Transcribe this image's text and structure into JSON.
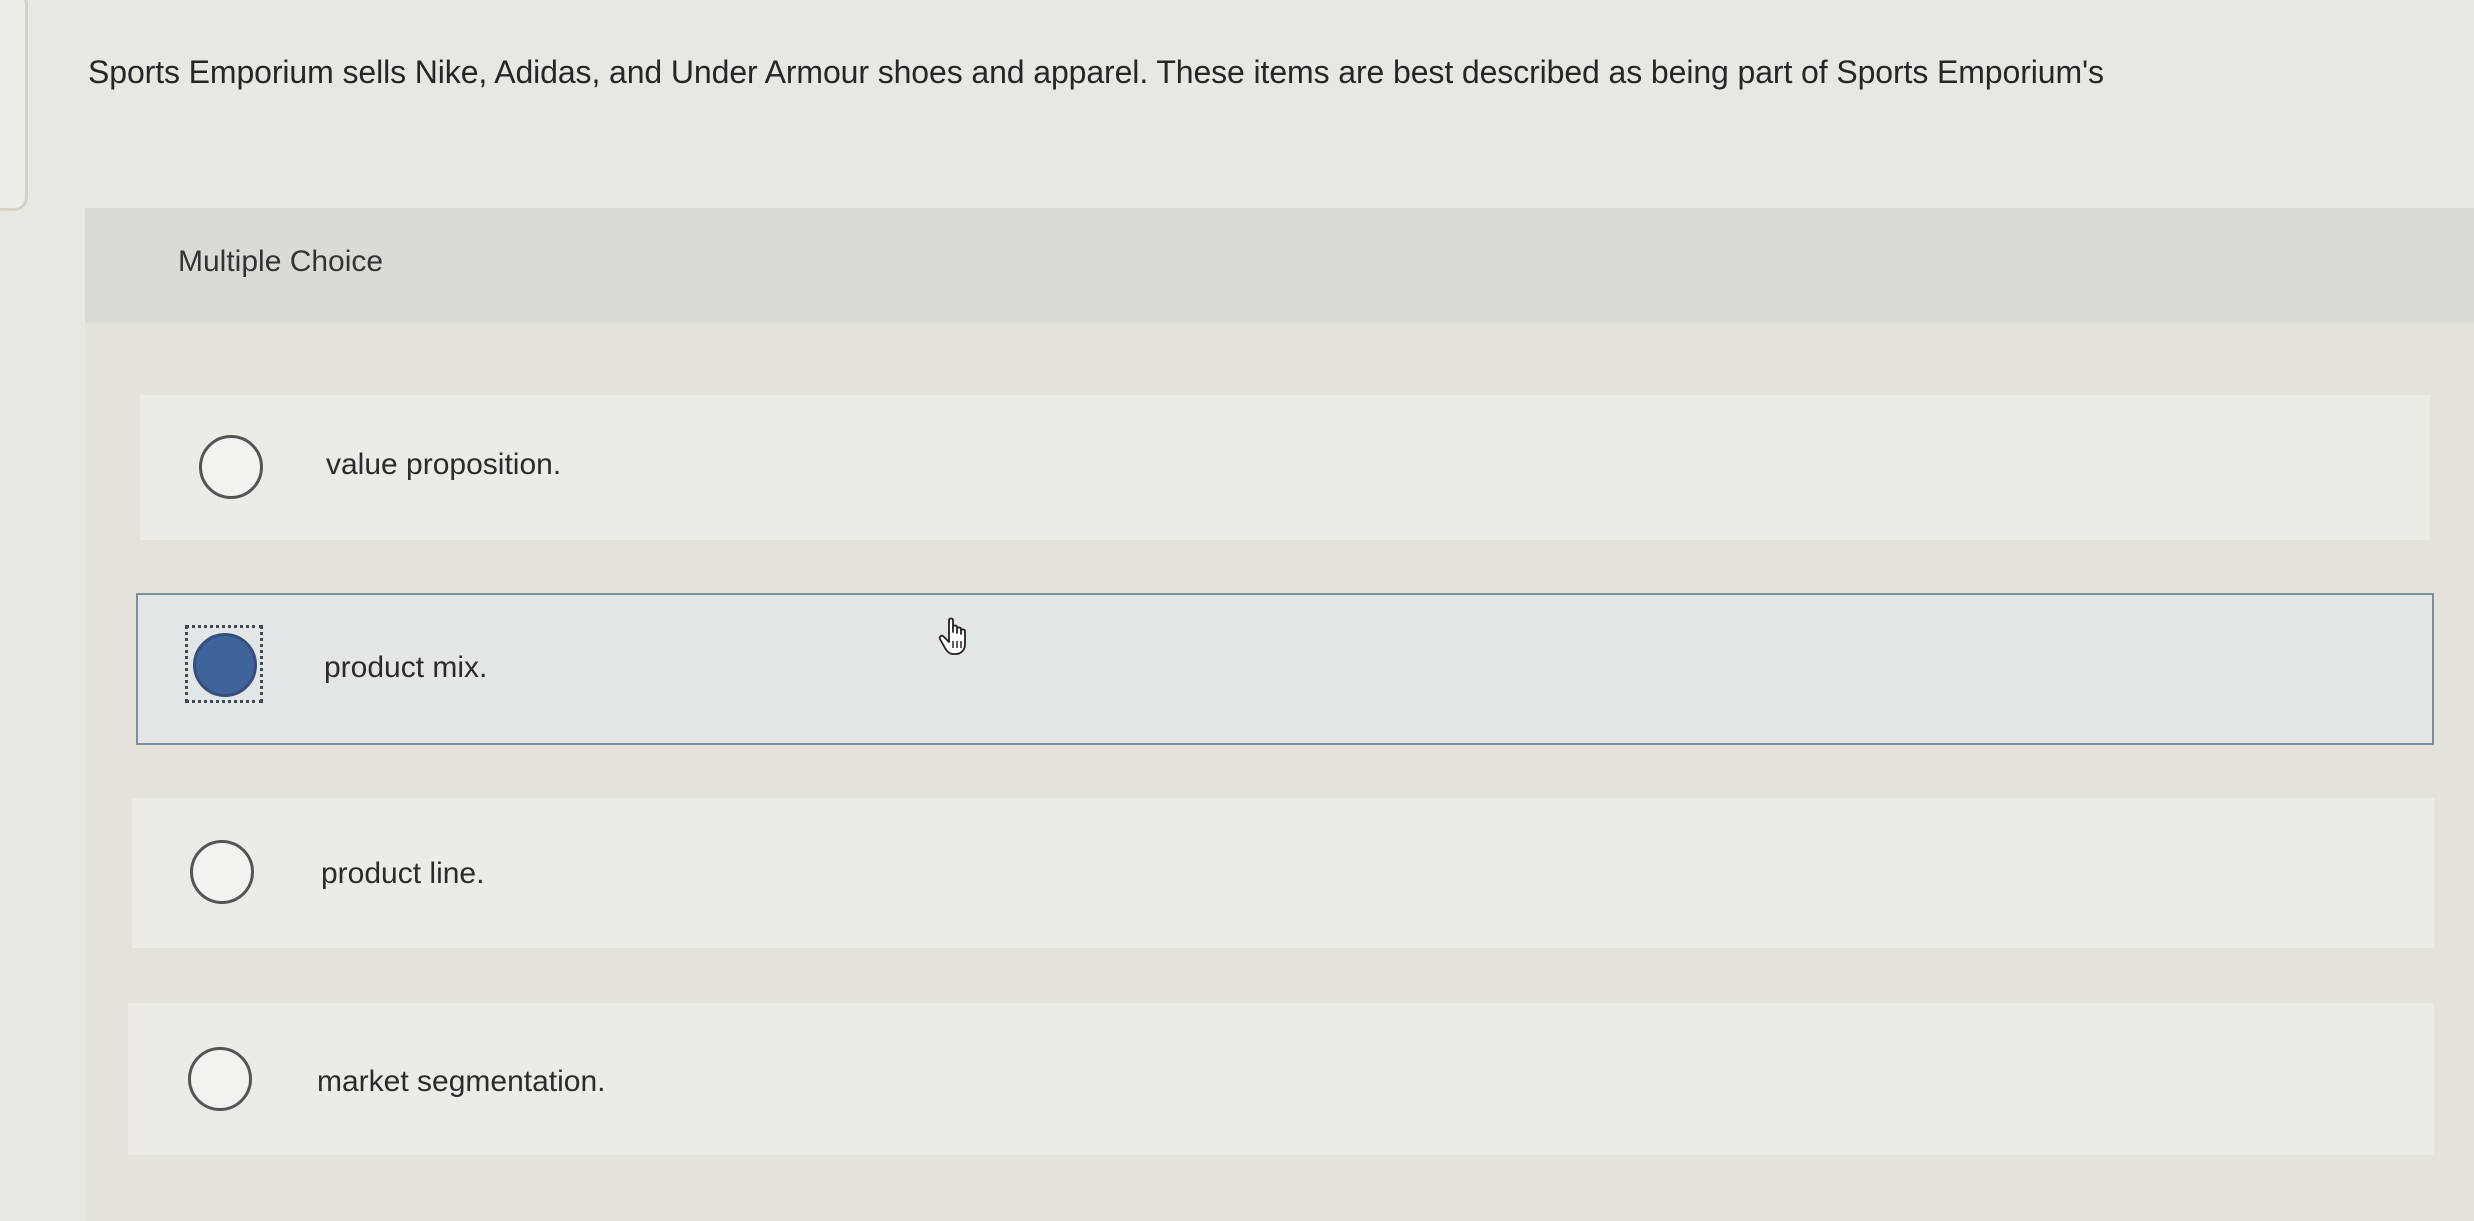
{
  "question": {
    "text": "Sports Emporium sells Nike, Adidas, and Under Armour shoes and apparel. These items are best described as being part of Sports Emporium's"
  },
  "section": {
    "label": "Multiple Choice"
  },
  "options": [
    {
      "label": "value proposition.",
      "selected": false
    },
    {
      "label": "product mix.",
      "selected": true
    },
    {
      "label": "product line.",
      "selected": false
    },
    {
      "label": "market segmentation.",
      "selected": false
    }
  ],
  "colors": {
    "selected_radio": "#3f639b",
    "selected_row_border": "#7f8e9c"
  },
  "icons": {
    "cursor": "pointer-hand-icon"
  }
}
